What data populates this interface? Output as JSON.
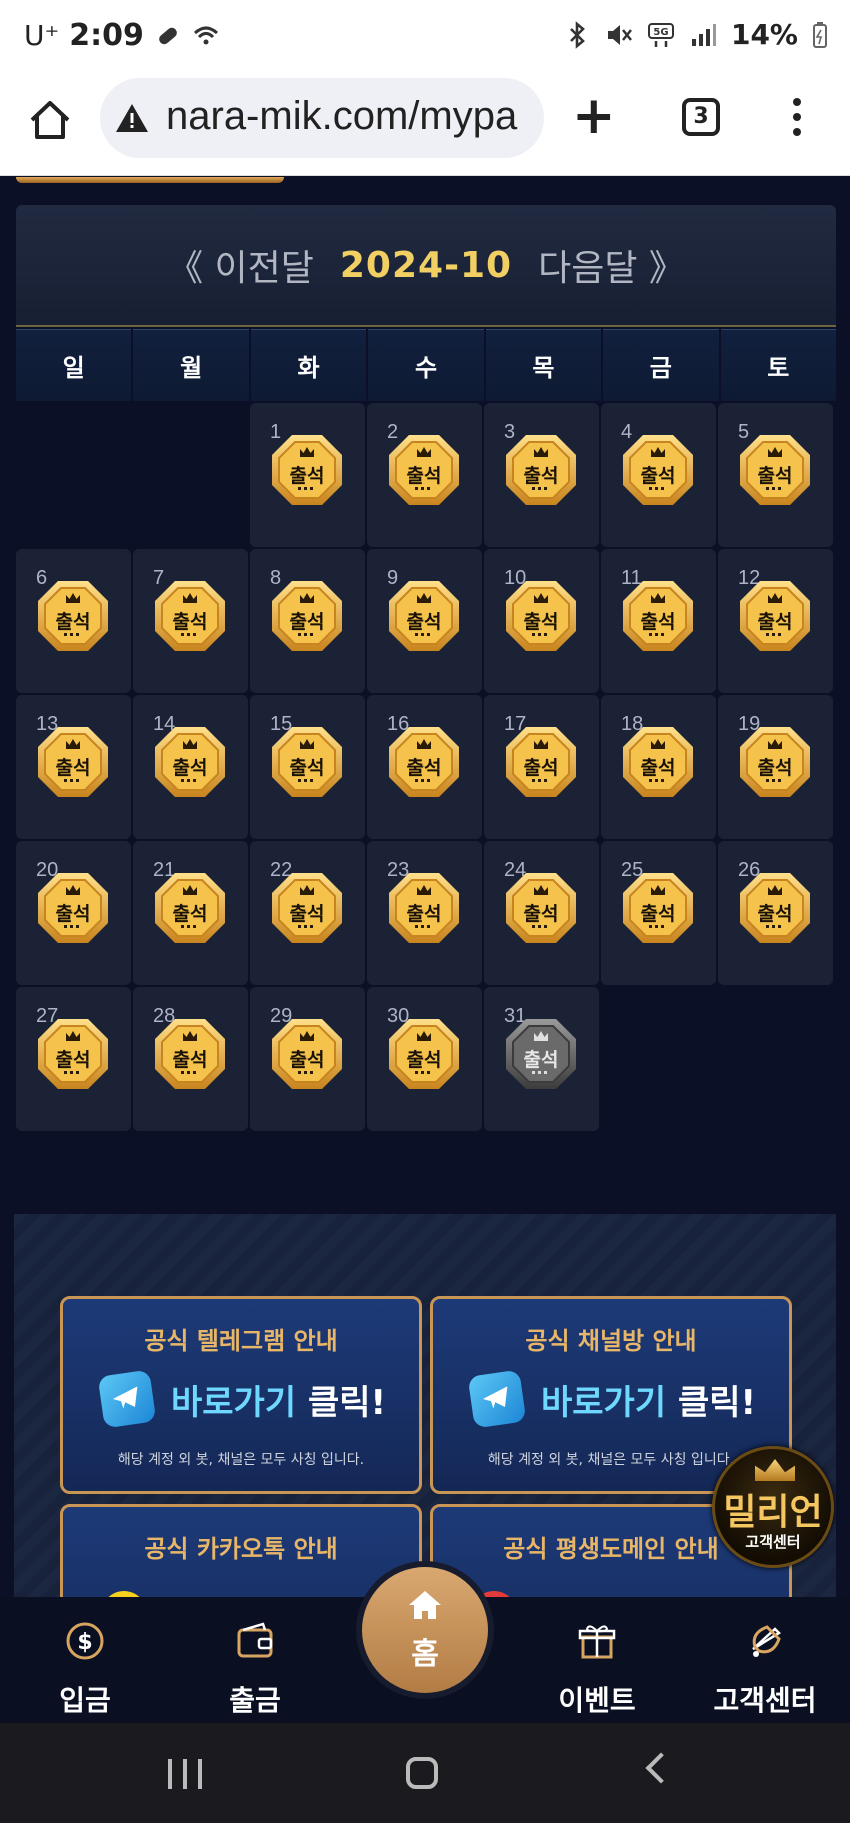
{
  "status": {
    "carrier": "U⁺",
    "time": "2:09",
    "battery": "14%"
  },
  "browser": {
    "url": "nara-mik.com/mypa",
    "tab_count": "3"
  },
  "calendar": {
    "prev": "《 이전달",
    "month": "2024-10",
    "next": "다음달 》",
    "weekdays": [
      "일",
      "월",
      "화",
      "수",
      "목",
      "금",
      "토"
    ],
    "badge_label": "출석",
    "days": [
      "1",
      "2",
      "3",
      "4",
      "5",
      "6",
      "7",
      "8",
      "9",
      "10",
      "11",
      "12",
      "13",
      "14",
      "15",
      "16",
      "17",
      "18",
      "19",
      "20",
      "21",
      "22",
      "23",
      "24",
      "25",
      "26",
      "27",
      "28",
      "29",
      "30",
      "31"
    ],
    "attended_through": 30
  },
  "promo": {
    "cards": [
      {
        "title": "공식 텔레그램 안내",
        "btn": "바로가기",
        "btn_hl": "클릭!",
        "sub": "해당 계정 외 봇, 채널은 모두 사칭 입니다."
      },
      {
        "title": "공식 채널방 안내",
        "btn": "바로가기",
        "btn_hl": "클릭!",
        "sub": "해당 계정 외 봇, 채널은 모두 사칭 입니다."
      },
      {
        "title": "공식 카카오톡 안내"
      },
      {
        "title": "공식 평생도메인 안내"
      }
    ],
    "million": {
      "title": "밀리언",
      "sub": "고객센터"
    }
  },
  "bottomnav": {
    "deposit": "입금",
    "withdraw": "출금",
    "home": "홈",
    "event": "이벤트",
    "support": "고객센터"
  }
}
